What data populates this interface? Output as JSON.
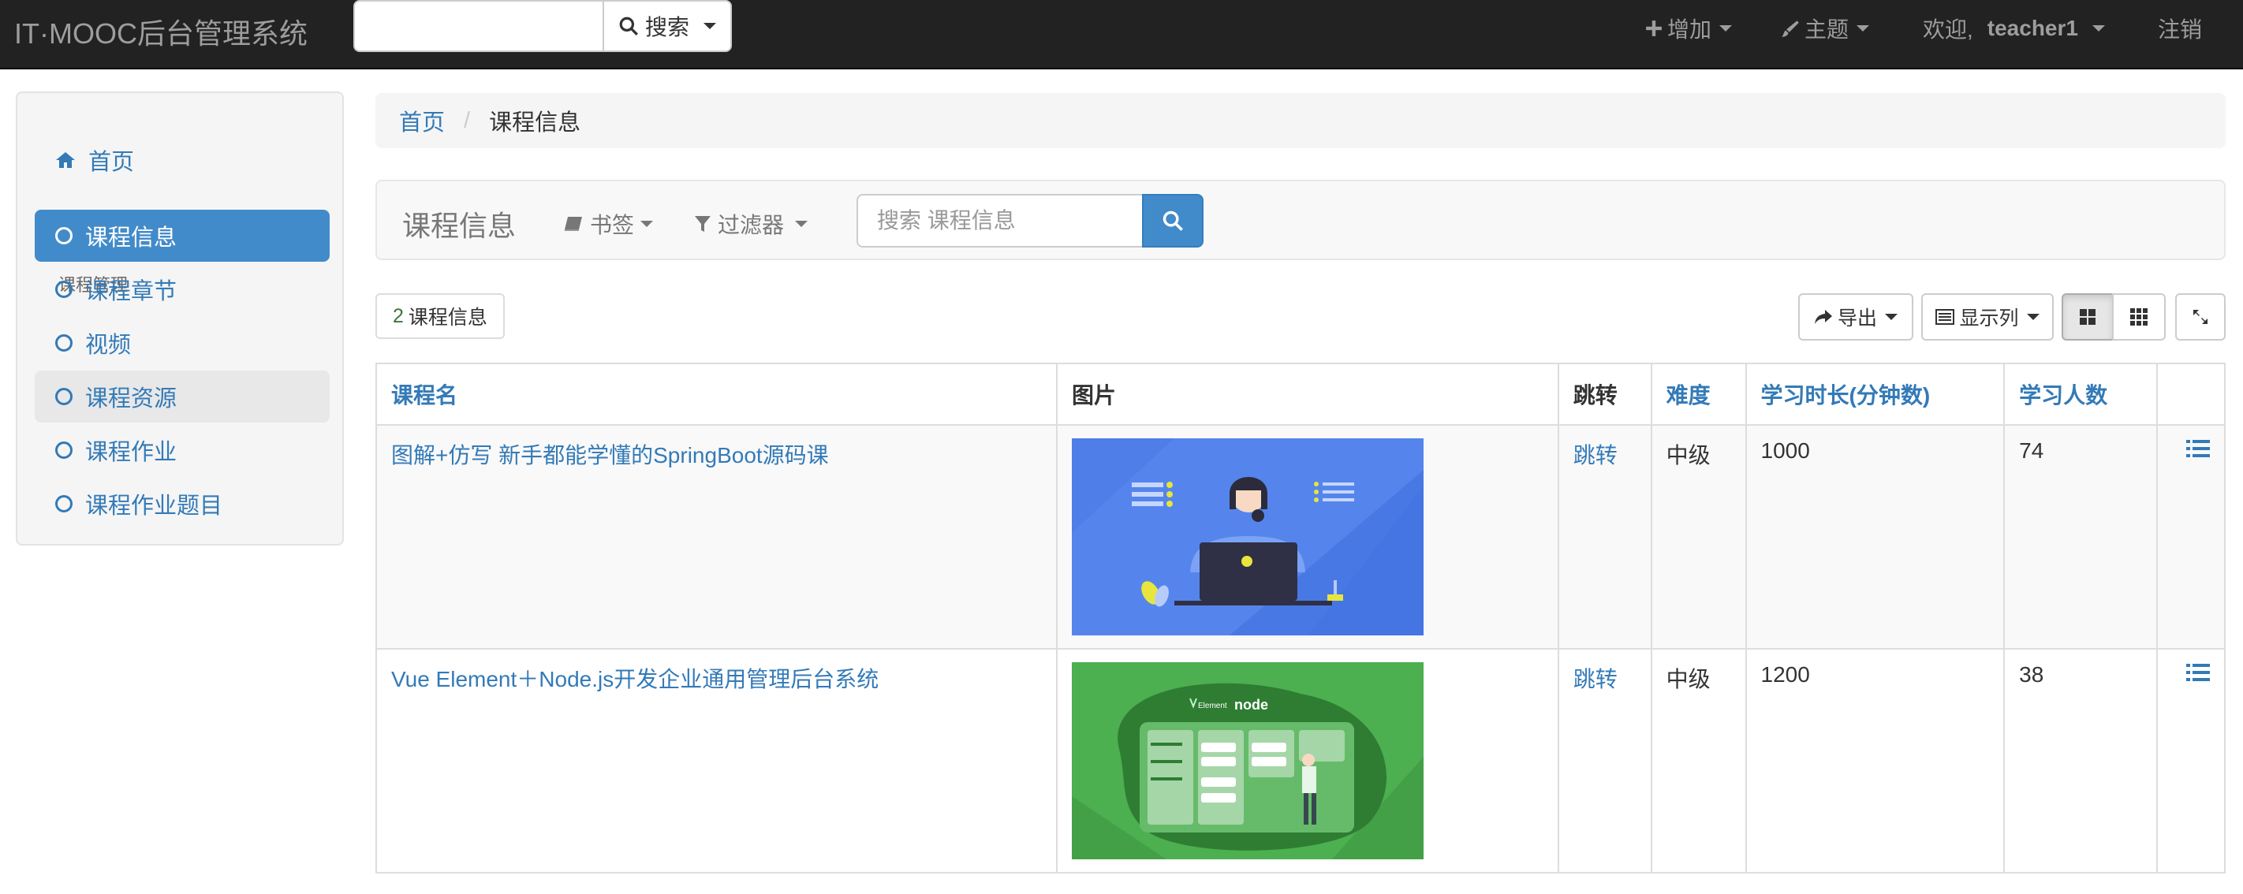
{
  "navbar": {
    "brand": "IT·MOOC后台管理系统",
    "search_button": "搜索",
    "add_menu": "增加",
    "theme_menu": "主题",
    "welcome_text": "欢迎,",
    "username": "teacher1",
    "logout": "注销"
  },
  "sidebar": {
    "home": "首页",
    "section_header": "课程管理",
    "items": [
      {
        "label": "课程信息"
      },
      {
        "label": "课程章节"
      },
      {
        "label": "视频"
      },
      {
        "label": "课程资源"
      },
      {
        "label": "课程作业"
      },
      {
        "label": "课程作业题目"
      }
    ]
  },
  "breadcrumb": {
    "home": "首页",
    "separator": "/",
    "current": "课程信息"
  },
  "toolbar": {
    "title": "课程信息",
    "bookmark": "书签",
    "filter": "过滤器",
    "search_placeholder": "搜索 课程信息"
  },
  "summary": {
    "count": "2",
    "label": "课程信息"
  },
  "actions": {
    "export": "导出",
    "columns": "显示列"
  },
  "table": {
    "headers": {
      "name": "课程名",
      "image": "图片",
      "jump": "跳转",
      "difficulty": "难度",
      "duration": "学习时长(分钟数)",
      "learners": "学习人数"
    },
    "rows": [
      {
        "name": "图解+仿写 新手都能学懂的SpringBoot源码课",
        "jump": "跳转",
        "difficulty": "中级",
        "duration": "1000",
        "learners": "74"
      },
      {
        "name": "Vue Element＋Node.js开发企业通用管理后台系统",
        "jump": "跳转",
        "difficulty": "中级",
        "duration": "1200",
        "learners": "38"
      }
    ]
  },
  "images": {
    "thumb2_brand": "Element",
    "thumb2_logo": "node"
  },
  "colors": {
    "navbar_bg": "#222222",
    "link": "#337ab7",
    "active": "#428bca",
    "thumb1_bg": "#4f7ee8",
    "thumb2_bg": "#4caf50"
  }
}
